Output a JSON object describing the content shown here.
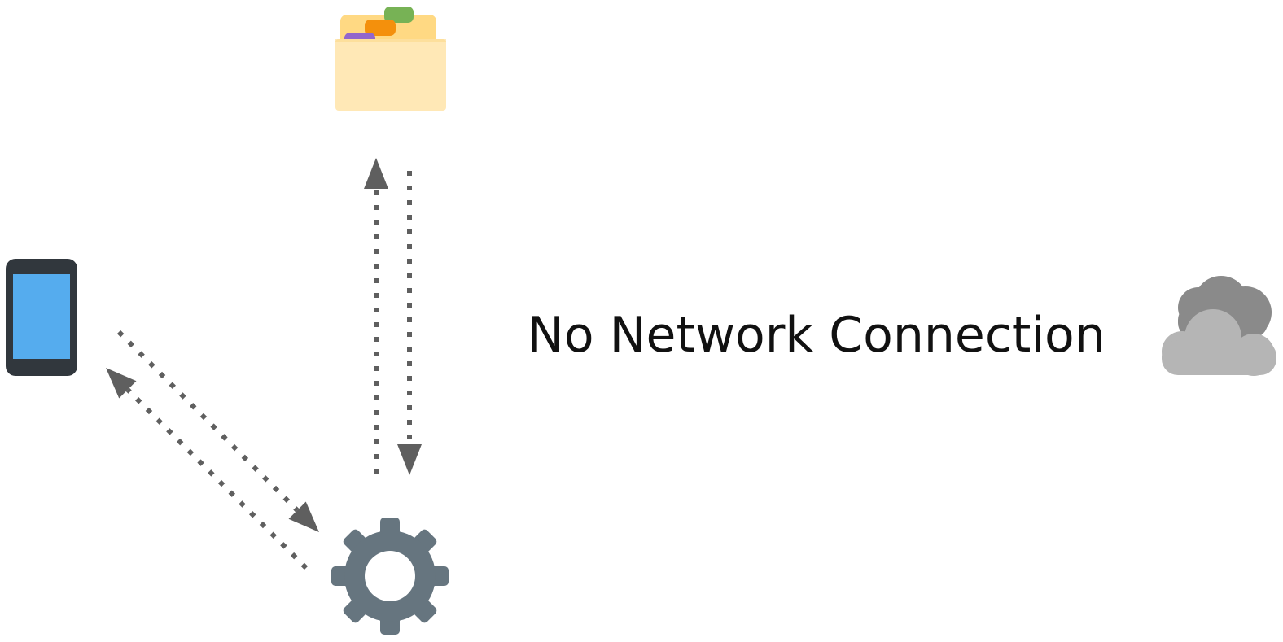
{
  "status": {
    "message": "No Network Connection"
  },
  "nodes": {
    "storage": {
      "icon": "card-file-box-icon"
    },
    "device": {
      "icon": "mobile-phone-icon"
    },
    "engine": {
      "icon": "gear-icon"
    },
    "cloud": {
      "icon": "cloud-icon",
      "state": "offline"
    }
  },
  "connections": [
    {
      "from": "engine",
      "to": "storage",
      "style": "dotted"
    },
    {
      "from": "storage",
      "to": "engine",
      "style": "dotted"
    },
    {
      "from": "device",
      "to": "engine",
      "style": "dotted"
    },
    {
      "from": "engine",
      "to": "device",
      "style": "dotted"
    }
  ],
  "colors": {
    "arrow": "#5f5f5f",
    "gear": "#66757f",
    "phone_body": "#31373d",
    "phone_screen": "#55acee",
    "cloud_back": "#8a8a8a",
    "cloud_front": "#b5b5b5",
    "box_body": "#ffe8b6",
    "box_lid": "#ffd983",
    "tab_purple": "#9266cc",
    "tab_orange": "#f4900c",
    "tab_green": "#77b255"
  }
}
